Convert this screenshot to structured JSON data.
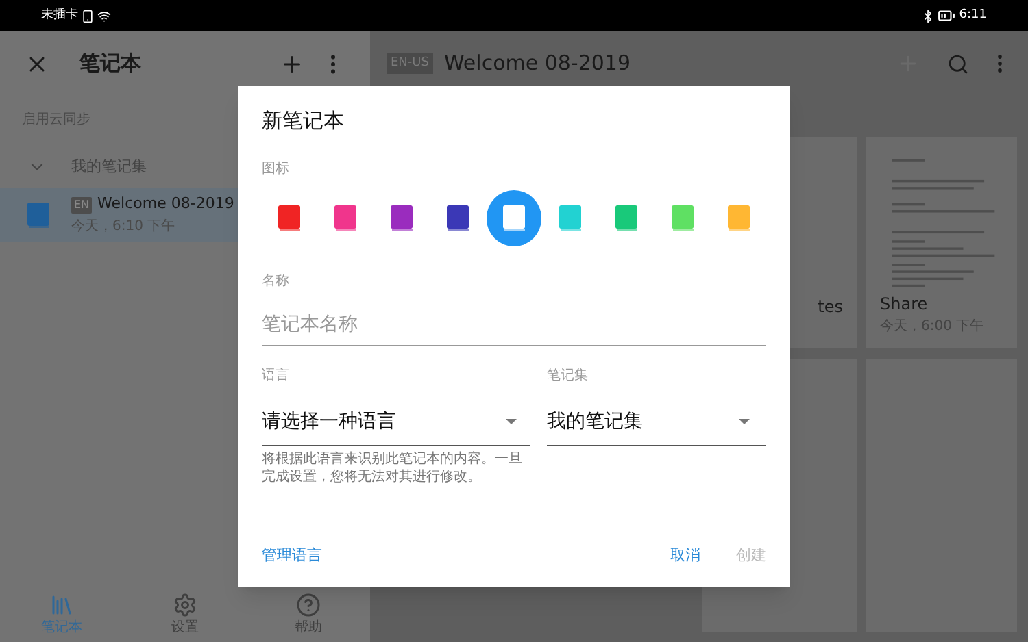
{
  "status_bar": {
    "carrier": "未插卡",
    "time": "6:11"
  },
  "sidebar": {
    "title": "笔记本",
    "sync": "启用云同步",
    "group": {
      "label": "我的笔记集",
      "expanded": true
    },
    "notebooks": [
      {
        "badge": "EN",
        "title": "Welcome 08-2019",
        "date": "今天，6:10 下午",
        "selected": true
      }
    ]
  },
  "bottom_nav": [
    {
      "kind": "notebooks",
      "label": "笔记本",
      "selected": true
    },
    {
      "kind": "settings",
      "label": "设置",
      "selected": false
    },
    {
      "kind": "help",
      "label": "帮助",
      "selected": false
    }
  ],
  "main": {
    "badge": "EN-US",
    "title": "Welcome 08-2019",
    "add_disabled": true,
    "cards": [
      {
        "kind": "cut",
        "title": "tes"
      },
      {
        "kind": "full",
        "title": "Share",
        "date": "今天，6:00 下午"
      }
    ]
  },
  "dialog": {
    "title": "新笔记本",
    "icon_label": "图标",
    "icons": [
      {
        "color": "#f02424",
        "selected": false
      },
      {
        "color": "#f0358c",
        "selected": false
      },
      {
        "color": "#9a2cbe",
        "selected": false
      },
      {
        "color": "#3b38b6",
        "selected": false
      },
      {
        "color": "#2196f3",
        "selected": true
      },
      {
        "color": "#22d2d2",
        "selected": false
      },
      {
        "color": "#19c97a",
        "selected": false
      },
      {
        "color": "#5fe063",
        "selected": false
      },
      {
        "color": "#ffb733",
        "selected": false
      }
    ],
    "name_label": "名称",
    "name_placeholder": "笔记本名称",
    "language_label": "语言",
    "language_value": "请选择一种语言",
    "notebook_label": "笔记集",
    "notebook_value": "我的笔记集",
    "helper": "将根据此语言来识别此笔记本的内容。一旦完成设置，您将无法对其进行修改。",
    "manage": "管理语言",
    "cancel": "取消",
    "create": {
      "label": "创建",
      "disabled": true
    }
  }
}
